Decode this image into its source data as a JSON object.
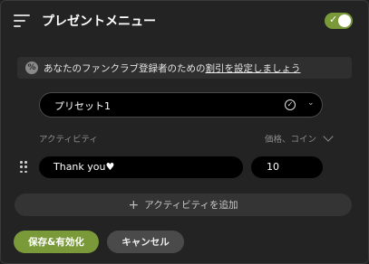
{
  "header": {
    "title": "プレゼントメニュー",
    "menu_icon": "menu-icon",
    "toggle_on": true,
    "toggle_check": "✓"
  },
  "notice": {
    "icon": "%",
    "text_prefix": "あなたのファンクラブ登録者のための",
    "link_text": "割引を設定しましょう"
  },
  "preset": {
    "selected": "プリセット1",
    "check_icon": "✓",
    "chevron": "⌄"
  },
  "columns": {
    "activity": "アクティビティ",
    "price": "価格、コイン"
  },
  "activities": [
    {
      "name": "Thank you♥",
      "price": "10"
    }
  ],
  "actions": {
    "add_plus": "+",
    "add_activity": "アクティビティを追加",
    "save": "保存&有効化",
    "cancel": "キャンセル"
  },
  "colors": {
    "accent": "#7a9a3a",
    "panel_bg": "#232323",
    "input_bg": "#000000"
  }
}
